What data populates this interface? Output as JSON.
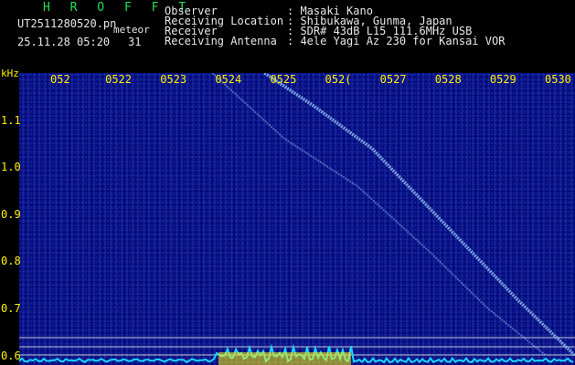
{
  "header": {
    "title": "H R O F F T",
    "filename": "UT2511280520.pn",
    "kind": "meteor",
    "datetime": "25.11.28 05:20",
    "count": "31"
  },
  "info": [
    {
      "label": "Observer",
      "value": ": Masaki Kano"
    },
    {
      "label": "Receiving Location",
      "value": ": Shibukawa, Gunma, Japan"
    },
    {
      "label": "Receiver",
      "value": ": SDR# 43dB L15 111.6MHz USB"
    },
    {
      "label": "Receiving Antenna",
      "value": ": 4ele Yagi Az 230 for Kansai VOR"
    }
  ],
  "colors": {
    "background": "#050a7a",
    "text_green": "#22e05a",
    "text_yellow": "#fff200",
    "echo": "#9fd0ff",
    "baseline": "#19d7ff"
  },
  "chart_data": {
    "type": "heatmap",
    "ylabel": "kHz",
    "y_ticks": [
      "1.1",
      "1.0",
      "0.9",
      "0.8",
      "0.7",
      "0.6"
    ],
    "x_ticks": [
      "052",
      "0522",
      "0523",
      "0524",
      "0525",
      "052(",
      "0527",
      "0528",
      "0529",
      "0530"
    ],
    "ylim": [
      0.58,
      1.2
    ],
    "grid": false,
    "echo_traces": [
      {
        "name": "main",
        "points": [
          [
            0.53,
            1.2
          ],
          [
            0.7,
            1.13
          ],
          [
            0.9,
            1.04
          ],
          [
            1.15,
            0.88
          ],
          [
            1.4,
            0.72
          ],
          [
            1.6,
            0.6
          ]
        ]
      },
      {
        "name": "secondary",
        "points": [
          [
            0.35,
            1.2
          ],
          [
            0.6,
            1.06
          ],
          [
            0.85,
            0.96
          ],
          [
            1.1,
            0.82
          ],
          [
            1.3,
            0.7
          ],
          [
            1.5,
            0.6
          ]
        ]
      }
    ]
  }
}
